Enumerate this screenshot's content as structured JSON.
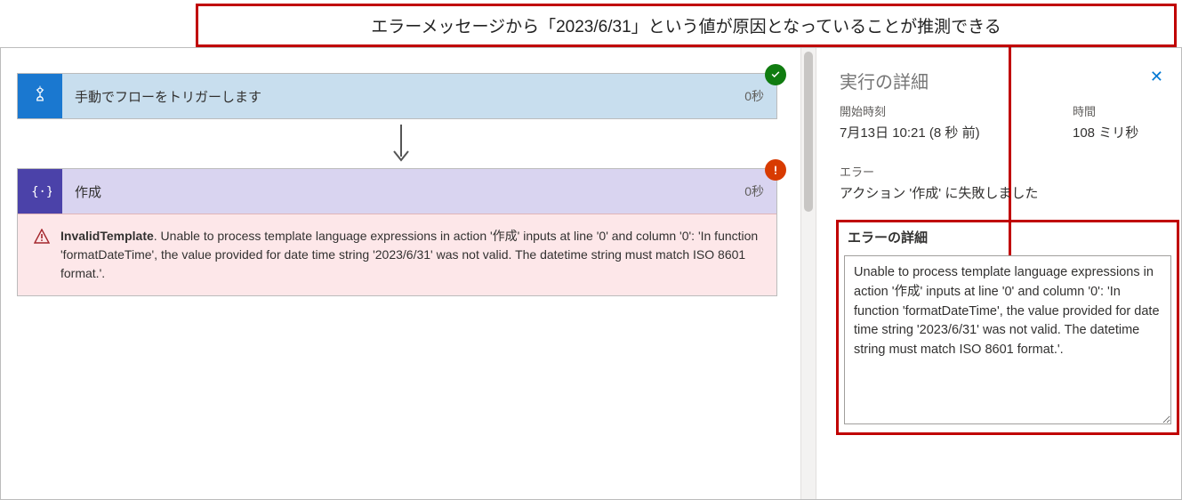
{
  "callout": {
    "text": "エラーメッセージから「2023/6/31」という値が原因となっていることが推測できる"
  },
  "flow": {
    "trigger": {
      "title": "手動でフローをトリガーします",
      "duration": "0秒"
    },
    "compose": {
      "title": "作成",
      "duration": "0秒"
    },
    "error": {
      "code": "InvalidTemplate",
      "message": ". Unable to process template language expressions in action '作成' inputs at line '0' and column '0': 'In function 'formatDateTime', the value provided for date time string '2023/6/31' was not valid. The datetime string must match ISO 8601 format.'."
    }
  },
  "side": {
    "title": "実行の詳細",
    "start_label": "開始時刻",
    "start_value": "7月13日 10:21 (8 秒 前)",
    "duration_label": "時間",
    "duration_value": "108 ミリ秒",
    "error_label": "エラー",
    "error_summary": "アクション '作成' に失敗しました",
    "error_details_label": "エラーの詳細",
    "error_details_text": "Unable to process template language expressions in action '作成' inputs at line '0' and column '0': 'In function 'formatDateTime', the value provided for date time string '2023/6/31' was not valid. The datetime string must match ISO 8601 format.'."
  }
}
